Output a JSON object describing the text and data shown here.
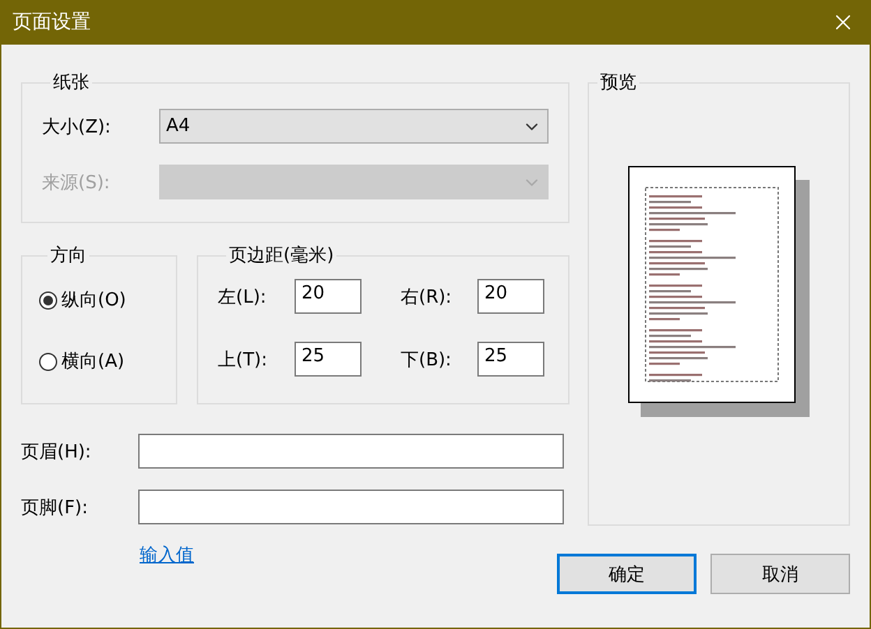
{
  "window": {
    "title": "页面设置"
  },
  "paper": {
    "legend": "纸张",
    "size": {
      "label": "大小(Z):",
      "value": "A4",
      "disabled": false
    },
    "source": {
      "label": "来源(S):",
      "disabled": true
    }
  },
  "orientation": {
    "legend": "方向",
    "options": [
      {
        "label": "纵向(O)",
        "selected": true
      },
      {
        "label": "横向(A)",
        "selected": false
      }
    ]
  },
  "margins": {
    "legend": "页边距(毫米)",
    "fields": [
      {
        "label": "左(L):",
        "value": "20"
      },
      {
        "label": "右(R):",
        "value": "20"
      },
      {
        "label": "上(T):",
        "value": "25"
      },
      {
        "label": "下(B):",
        "value": "25"
      }
    ]
  },
  "header": {
    "label": "页眉(H):"
  },
  "footer": {
    "label": "页脚(F):"
  },
  "link": "输入值",
  "preview": {
    "legend": "预览"
  },
  "buttons": [
    {
      "label": "确定",
      "default": true
    },
    {
      "label": "取消",
      "default": false
    }
  ]
}
